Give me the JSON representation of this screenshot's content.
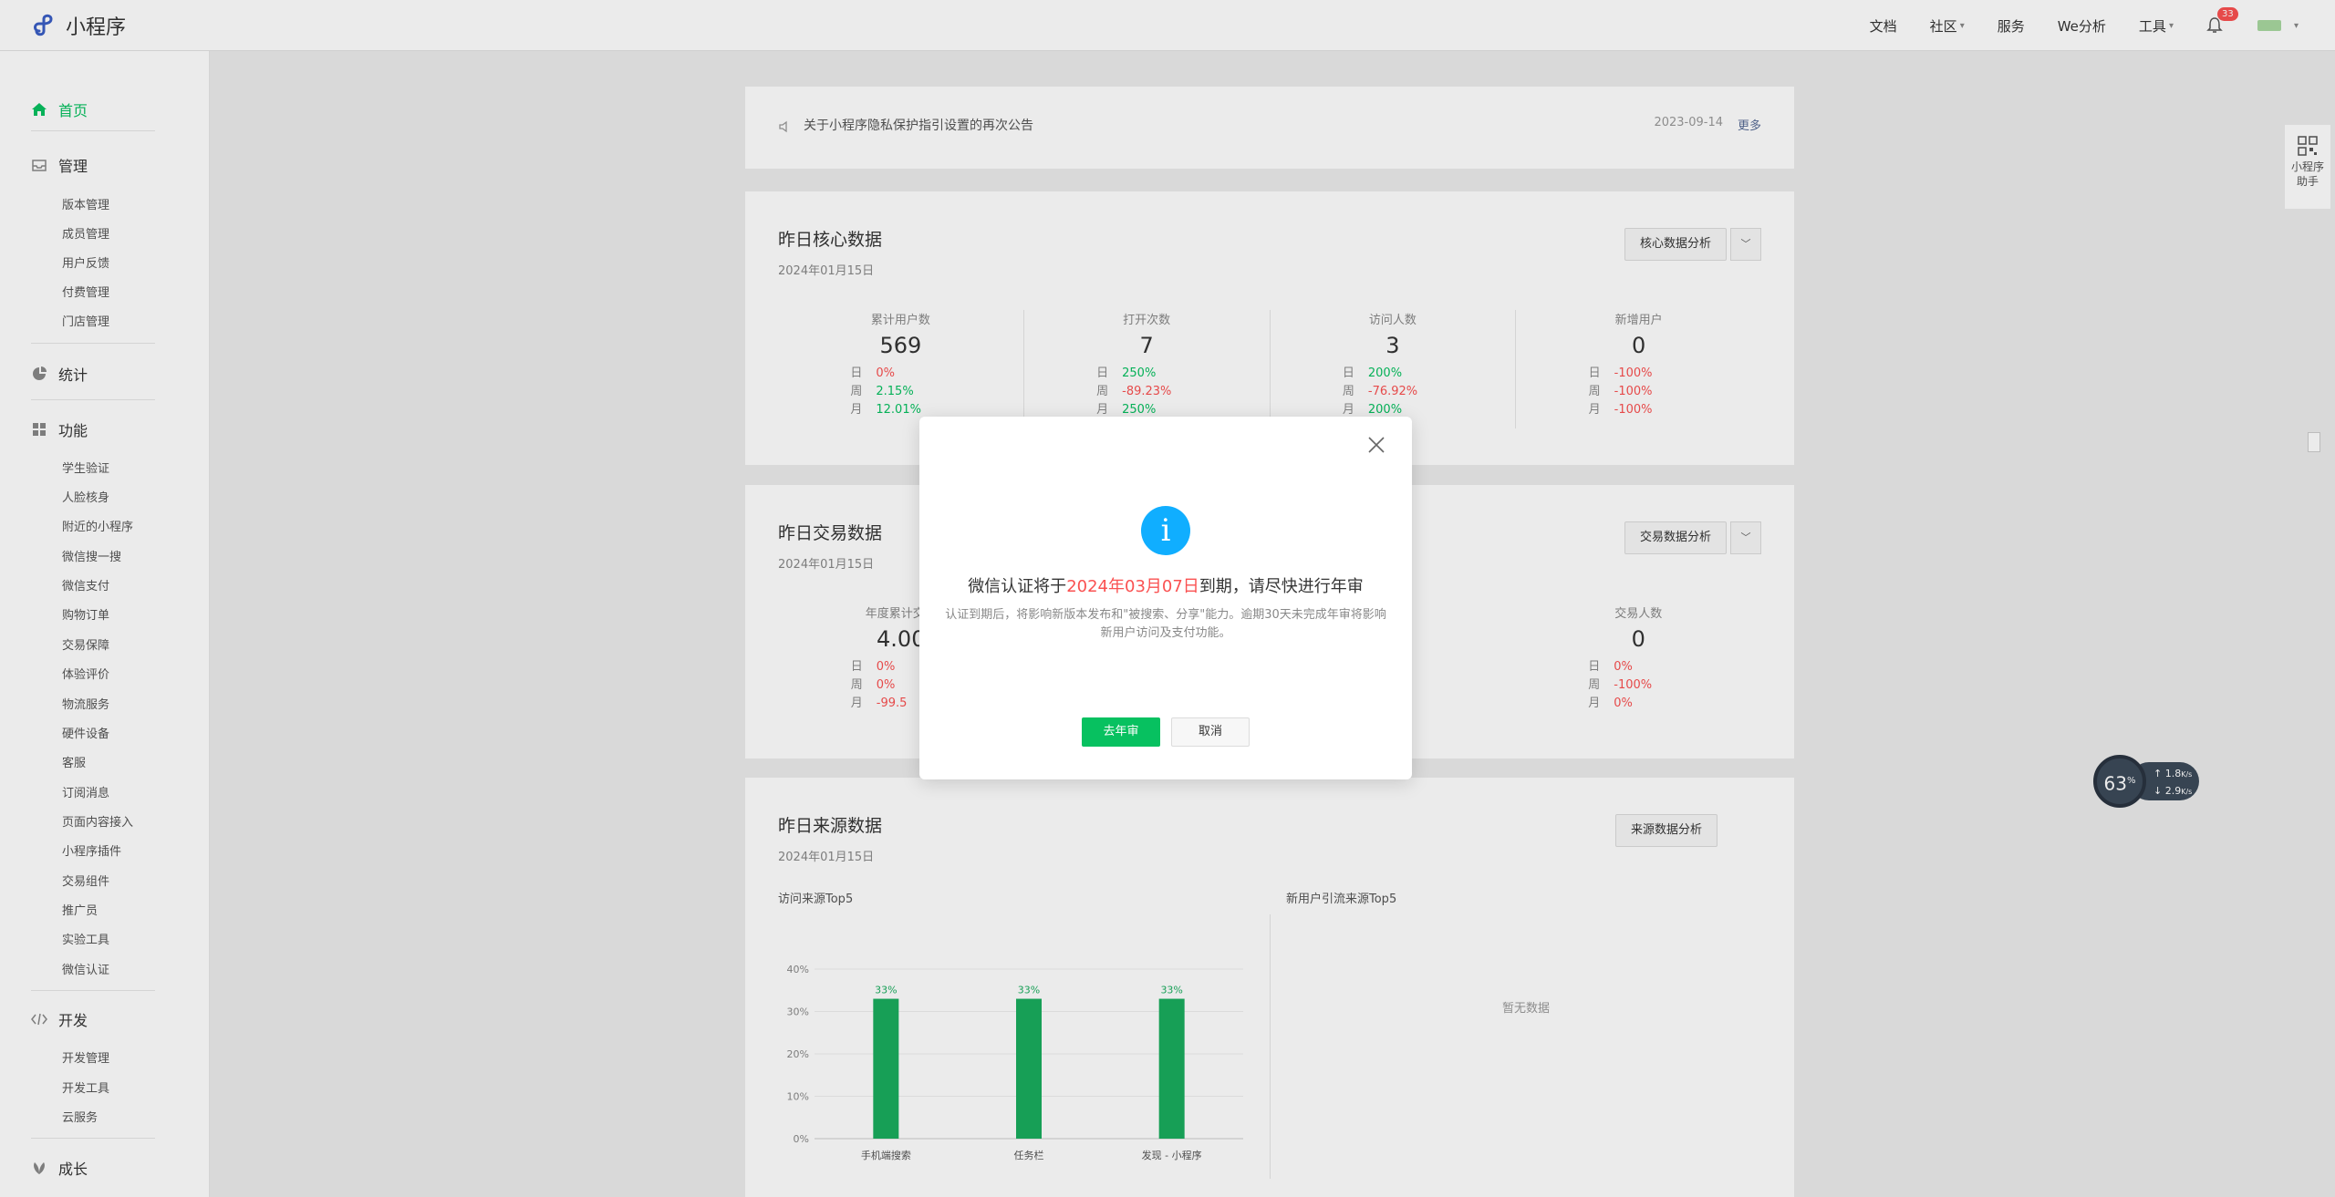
{
  "app": {
    "title": "小程序"
  },
  "topnav": {
    "docs": "文档",
    "community": "社区",
    "services": "服务",
    "we_analytics": "We分析",
    "tools": "工具",
    "notification_count": "33"
  },
  "sidebar": {
    "home": "首页",
    "manage": {
      "label": "管理",
      "items": [
        "版本管理",
        "成员管理",
        "用户反馈",
        "付费管理",
        "门店管理"
      ]
    },
    "stats": "统计",
    "features": {
      "label": "功能",
      "items": [
        "学生验证",
        "人脸核身",
        "附近的小程序",
        "微信搜一搜",
        "微信支付",
        "购物订单",
        "交易保障",
        "体验评价",
        "物流服务",
        "硬件设备",
        "客服",
        "订阅消息",
        "页面内容接入",
        "小程序插件",
        "交易组件",
        "推广员",
        "实验工具",
        "微信认证"
      ]
    },
    "dev": {
      "label": "开发",
      "items": [
        "开发管理",
        "开发工具",
        "云服务"
      ]
    },
    "growth": "成长"
  },
  "notice": {
    "text": "关于小程序隐私保护指引设置的再次公告",
    "date": "2023-09-14",
    "more": "更多"
  },
  "core": {
    "title": "昨日核心数据",
    "date": "2024年01月15日",
    "analysis_button": "核心数据分析",
    "metrics": [
      {
        "label": "累计用户数",
        "value": "569",
        "day": "0%",
        "week": "2.15%",
        "month": "12.01%"
      },
      {
        "label": "打开次数",
        "value": "7",
        "day": "250%",
        "week": "-89.23%",
        "month": "250%"
      },
      {
        "label": "访问人数",
        "value": "3",
        "day": "200%",
        "week": "-76.92%",
        "month": "200%"
      },
      {
        "label": "新增用户",
        "value": "0",
        "day": "-100%",
        "week": "-100%",
        "month": "-100%"
      }
    ],
    "row_labels": {
      "day": "日",
      "week": "周",
      "month": "月"
    }
  },
  "trade": {
    "title": "昨日交易数据",
    "date": "2024年01月15日",
    "analysis_button": "交易数据分析",
    "metrics": [
      {
        "label": "年度累计交易",
        "value": "4.00",
        "day": "0%",
        "week": "0%",
        "month": "-99.5"
      },
      {
        "label": "交易人数",
        "value": "0",
        "day": "0%",
        "week": "-100%",
        "month": "0%"
      }
    ]
  },
  "source": {
    "title": "昨日来源数据",
    "date": "2024年01月15日",
    "analysis_button": "来源数据分析",
    "left_title": "访问来源Top5",
    "right_title": "新用户引流来源Top5",
    "empty_text": "暂无数据"
  },
  "chart_data": {
    "type": "bar",
    "categories": [
      "手机端搜索",
      "任务栏",
      "发现 - 小程序"
    ],
    "values": [
      33,
      33,
      33
    ],
    "data_labels": [
      "33%",
      "33%",
      "33%"
    ],
    "yticks": [
      "0%",
      "10%",
      "20%",
      "30%",
      "40%"
    ],
    "ylim": [
      0,
      40
    ],
    "bar_color": "#1aad5e"
  },
  "helper": {
    "line1": "小程序",
    "line2": "助手"
  },
  "speed": {
    "percent": "63",
    "unit": "%",
    "up": "1.8",
    "down": "2.9",
    "rate_unit": "K/s"
  },
  "modal": {
    "title_prefix": "微信认证将于",
    "title_highlight": "2024年03月07日",
    "title_suffix": "到期，请尽快进行年审",
    "desc": "认证到期后，将影响新版本发布和\"被搜索、分享\"能力。逾期30天未完成年审将影响新用户访问及支付功能。",
    "confirm": "去年审",
    "cancel": "取消"
  },
  "colors": {
    "accent": "#07c160",
    "danger": "#fa5151",
    "info": "#10aeff"
  }
}
